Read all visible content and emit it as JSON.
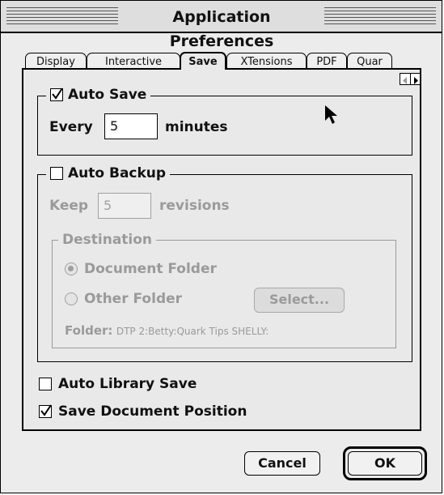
{
  "window": {
    "title": "Application Preferences"
  },
  "tabs": [
    {
      "label": "Display"
    },
    {
      "label": "Interactive"
    },
    {
      "label": "Save",
      "active": true
    },
    {
      "label": "XTensions"
    },
    {
      "label": "PDF"
    },
    {
      "label": "Quar"
    }
  ],
  "auto_save": {
    "label": "Auto Save",
    "checked": true,
    "every_label": "Every",
    "value": "5",
    "unit": "minutes"
  },
  "auto_backup": {
    "label": "Auto Backup",
    "checked": false,
    "keep_label": "Keep",
    "value": "5",
    "unit": "revisions"
  },
  "destination": {
    "label": "Destination",
    "option_document": "Document Folder",
    "option_other": "Other Folder",
    "selected": "Document Folder",
    "select_button": "Select...",
    "folder_label": "Folder:",
    "folder_path": "DTP 2:Betty:Quark Tips SHELLY:"
  },
  "auto_library_save": {
    "label": "Auto Library Save",
    "checked": false
  },
  "save_document_position": {
    "label": "Save Document Position",
    "checked": true
  },
  "buttons": {
    "cancel": "Cancel",
    "ok": "OK"
  }
}
